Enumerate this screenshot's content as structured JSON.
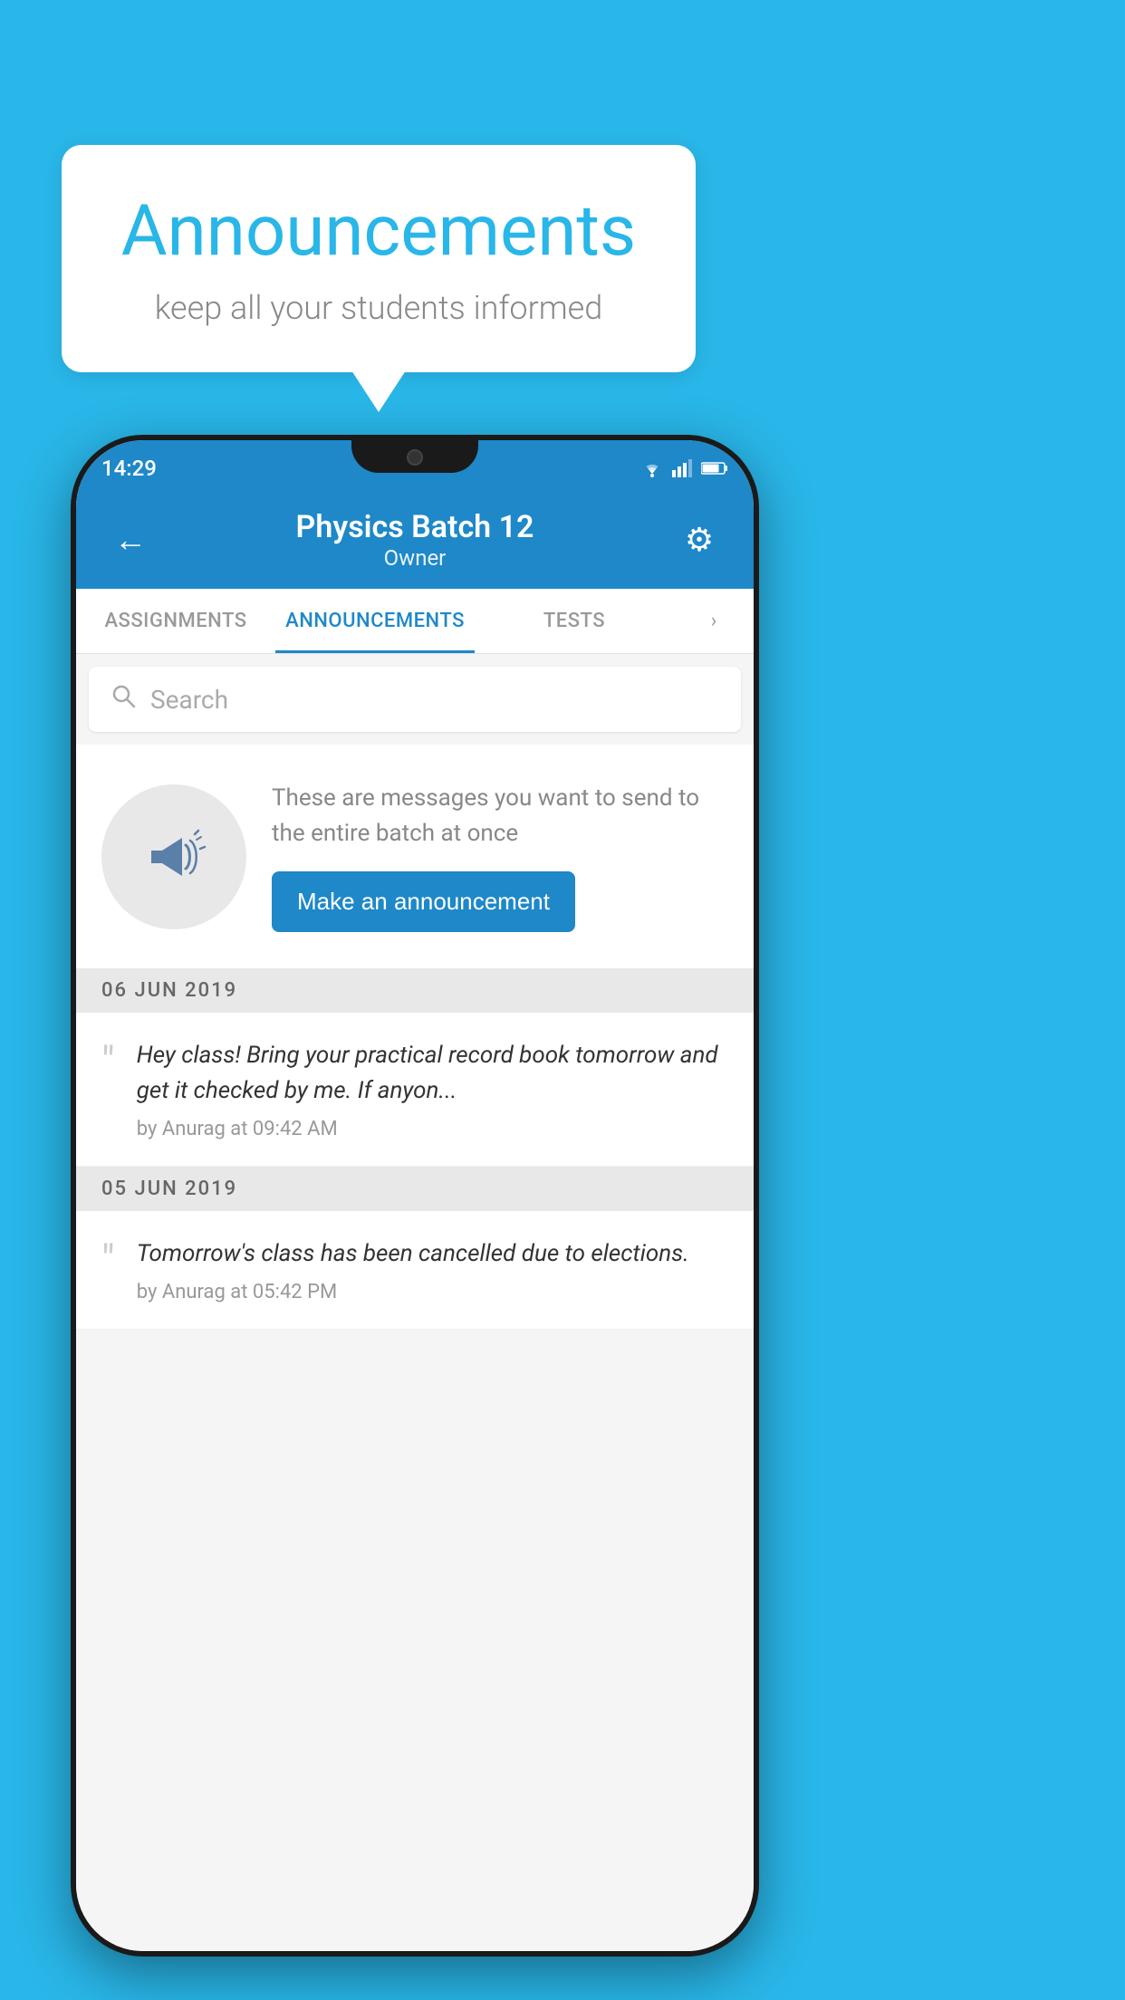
{
  "background_color": "#29b6e8",
  "speech_bubble": {
    "title": "Announcements",
    "subtitle": "keep all your students informed"
  },
  "phone": {
    "status_bar": {
      "time": "14:29"
    },
    "app_bar": {
      "title": "Physics Batch 12",
      "subtitle": "Owner",
      "back_label": "←",
      "gear_label": "⚙"
    },
    "tabs": [
      {
        "label": "ASSIGNMENTS",
        "active": false
      },
      {
        "label": "ANNOUNCEMENTS",
        "active": true
      },
      {
        "label": "TESTS",
        "active": false
      }
    ],
    "search": {
      "placeholder": "Search"
    },
    "promo": {
      "description": "These are messages you want to send to the entire batch at once",
      "button_label": "Make an announcement"
    },
    "announcements": [
      {
        "date": "06  JUN  2019",
        "items": [
          {
            "text": "Hey class! Bring your practical record book tomorrow and get it checked by me. If anyon...",
            "meta": "by Anurag at 09:42 AM"
          }
        ]
      },
      {
        "date": "05  JUN  2019",
        "items": [
          {
            "text": "Tomorrow's class has been cancelled due to elections.",
            "meta": "by Anurag at 05:42 PM"
          }
        ]
      }
    ]
  }
}
